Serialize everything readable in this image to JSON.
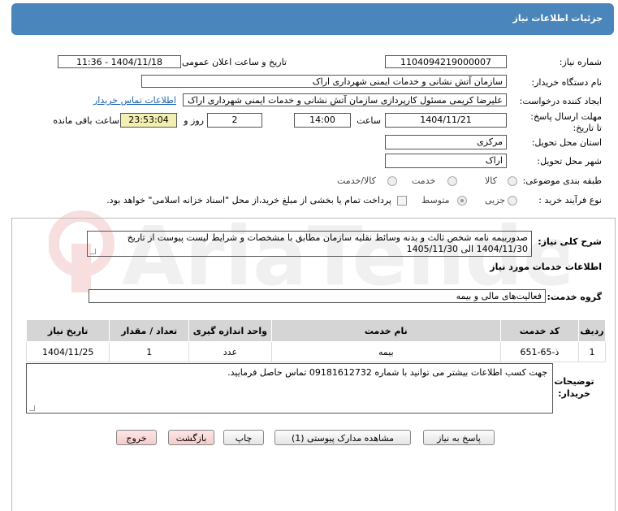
{
  "header": {
    "title": "جزئیات اطلاعات نیاز"
  },
  "fields": {
    "need_number_label": "شماره نیاز:",
    "need_number": "1104094219000007",
    "announce_label": "تاریخ و ساعت اعلان عمومی:",
    "announce_value": "1404/11/18 - 11:36",
    "buyer_org_label": "نام دستگاه خریدار:",
    "buyer_org": "سازمان آتش نشانی و خدمات ایمنی شهرداری اراک",
    "creator_label": "ایجاد کننده درخواست:",
    "creator": "علیرضا  کریمی  مسئول کارپردازی سازمان آتش نشانی و خدمات ایمنی شهرداری اراک",
    "contact_link": "اطلاعات تماس خریدار",
    "deadline_label": "مهلت ارسال پاسخ: تا تاریخ:",
    "deadline_date": "1404/11/21",
    "time_label": "ساعت",
    "deadline_time": "14:00",
    "days_value": "2",
    "days_label": "روز و",
    "remaining_time": "23:53:04",
    "remaining_label": "ساعت باقی مانده",
    "province_label": "استان محل تحویل:",
    "province": "مرکزی",
    "city_label": "شهر محل تحویل:",
    "city": "اراک",
    "category_label": "طبقه بندی موضوعی:",
    "category_options": [
      "کالا",
      "خدمت",
      "کالا/خدمت"
    ],
    "process_label": "نوع فرآیند خرید :",
    "process_options": [
      "جزیی",
      "متوسط"
    ],
    "payment_note": "پرداخت تمام یا بخشی از مبلغ خرید،از محل \"اسناد خزانه اسلامی\" خواهد بود."
  },
  "description": {
    "label": "شرح کلی نیاز:",
    "text": "صدوربیمه نامه شخص ثالث و بدنه وسائط نقلیه سازمان مطابق با مشخصات و شرایط لیست پیوست از تاریخ 1404/11/30 الی 1405/11/30"
  },
  "services": {
    "section_title": "اطلاعات خدمات مورد نیاز",
    "group_label": "گروه خدمت:",
    "group_value": "فعالیت‌های مالی و بیمه",
    "columns": [
      "ردیف",
      "کد خدمت",
      "نام خدمت",
      "واحد اندازه گیری",
      "تعداد / مقدار",
      "تاریخ نیاز"
    ],
    "rows": [
      {
        "row": "1",
        "code": "ذ-65-651",
        "name": "بیمه",
        "unit": "عدد",
        "qty": "1",
        "date": "1404/11/25"
      }
    ]
  },
  "buyer_notes": {
    "label": "توضیحات خریدار:",
    "text": "جهت کسب اطلاعات بیشتر می توانید با شماره 09181612732 تماس حاصل فرمایید."
  },
  "buttons": {
    "reply": "پاسخ به نیاز",
    "attachments": "مشاهده مدارک پیوستی (1)",
    "print": "چاپ",
    "back": "بازگشت",
    "exit": "خروج"
  },
  "watermark": {
    "text": "AriaTender.net"
  }
}
